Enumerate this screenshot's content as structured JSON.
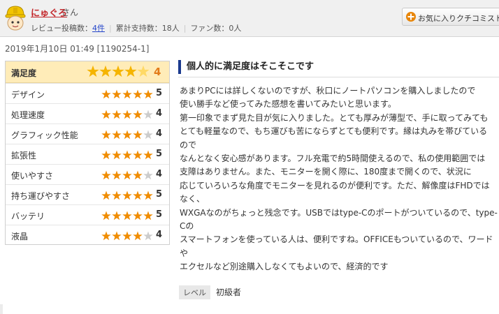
{
  "reviewer": {
    "name": "にゅぐろ",
    "suffix": "さん",
    "review_count_label": "レビュー投稿数：",
    "review_count": "4件",
    "support_label": "累計支持数：18人",
    "fan_label": "ファン数：0人",
    "favorite_button": "お気に入りクチコミストに登"
  },
  "post": {
    "date": "2019年1月10日 01:49 [1190254-1]"
  },
  "rating": {
    "overall_label": "満足度",
    "overall_score": "4",
    "overall_stars": 4,
    "items": [
      {
        "label": "デザイン",
        "score": "5",
        "stars": 5
      },
      {
        "label": "処理速度",
        "score": "4",
        "stars": 4
      },
      {
        "label": "グラフィック性能",
        "score": "4",
        "stars": 4
      },
      {
        "label": "拡張性",
        "score": "5",
        "stars": 5
      },
      {
        "label": "使いやすさ",
        "score": "4",
        "stars": 4
      },
      {
        "label": "持ち運びやすさ",
        "score": "5",
        "stars": 5
      },
      {
        "label": "バッテリ",
        "score": "5",
        "stars": 5
      },
      {
        "label": "液晶",
        "score": "4",
        "stars": 4
      }
    ],
    "star_color": "#f08c00",
    "star_empty_color": "#cccccc"
  },
  "review": {
    "title": "個人的に満足度はそこそこです",
    "lines": [
      "あまりPCには詳しくないのですが、秋口にノートパソコンを購入しましたので",
      "使い勝手など使ってみた感想を書いてみたいと思います。",
      "第一印象でまず見た目が気に入りました。とても厚みが薄型で、手に取ってみても",
      "とても軽量なので、もち運びも苦にならずとても便利です。縁は丸みを帯びている",
      "ので",
      "なんとなく安心感があります。フル充電で約5時間使えるので、私の使用範囲では",
      "支障はありません。また、モニターを開く際に、180度まで開くので、状況に",
      "応じていろいろな角度でモニターを見れるのが便利です。ただ、解像度はFHDでは",
      "なく、",
      "WXGAなのがちょっと残念です。USBではtype-Cのポートがついているので、type-",
      "Cの",
      "スマートフォンを使っている人は、便利ですね。OFFICEもついているので、ワード",
      "や",
      "エクセルなど別途購入しなくてもよいので、経済的です"
    ],
    "level_label": "レベル",
    "level_value": "初級者"
  },
  "colors": {
    "accent_red": "#c3272b",
    "title_bar": "#1b3a8e",
    "overall_bg": "#ffecb8",
    "score_orange": "#e27b1a"
  }
}
